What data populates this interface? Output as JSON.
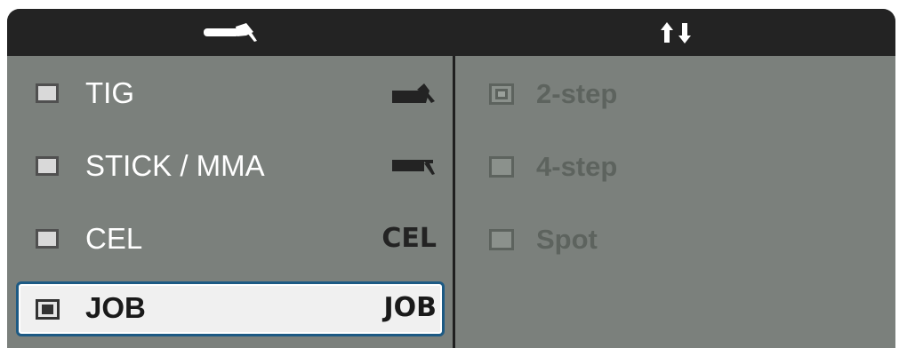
{
  "header": {
    "left_icon": "welding-torch-icon",
    "right_icon": "up-down-arrows-icon"
  },
  "process_modes": [
    {
      "label": "TIG",
      "icon": "tig-torch-icon",
      "selected": false
    },
    {
      "label": "STICK / MMA",
      "icon": "stick-electrode-icon",
      "selected": false
    },
    {
      "label": "CEL",
      "icon_text": "CEL",
      "selected": false
    },
    {
      "label": "JOB",
      "icon_text": "JOB",
      "selected": true
    }
  ],
  "trigger_modes": [
    {
      "label": "2-step",
      "active": true
    },
    {
      "label": "4-step",
      "active": false
    },
    {
      "label": "Spot",
      "active": false
    }
  ],
  "colors": {
    "header_bg": "#232323",
    "panel_bg": "#7b807c",
    "selection_border": "#1d5a84",
    "disabled_text": "#5d635e"
  }
}
